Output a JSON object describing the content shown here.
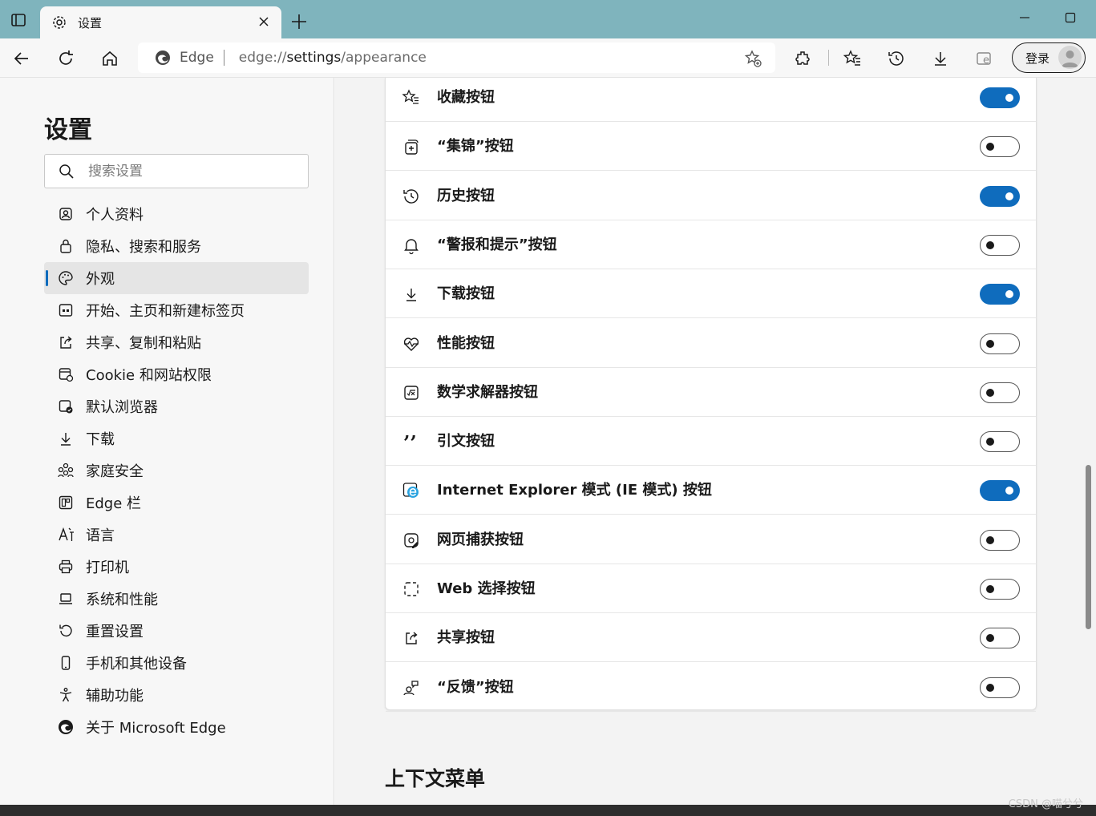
{
  "tab": {
    "title": "设置",
    "icon": "gear-icon"
  },
  "address_bar": {
    "site_name": "Edge",
    "url_prefix": "edge://",
    "url_host": "settings",
    "url_path": "/appearance"
  },
  "toolbar": {
    "login_label": "登录"
  },
  "sidebar": {
    "title": "设置",
    "search_placeholder": "搜索设置",
    "items": [
      {
        "label": "个人资料",
        "icon": "profile-icon"
      },
      {
        "label": "隐私、搜索和服务",
        "icon": "lock-icon"
      },
      {
        "label": "外观",
        "icon": "palette-icon",
        "active": true
      },
      {
        "label": "开始、主页和新建标签页",
        "icon": "start-page-icon"
      },
      {
        "label": "共享、复制和粘贴",
        "icon": "share-icon"
      },
      {
        "label": "Cookie 和网站权限",
        "icon": "site-permissions-icon"
      },
      {
        "label": "默认浏览器",
        "icon": "default-browser-icon"
      },
      {
        "label": "下载",
        "icon": "download-icon"
      },
      {
        "label": "家庭安全",
        "icon": "family-icon"
      },
      {
        "label": "Edge 栏",
        "icon": "edge-bar-icon"
      },
      {
        "label": "语言",
        "icon": "language-icon"
      },
      {
        "label": "打印机",
        "icon": "printer-icon"
      },
      {
        "label": "系统和性能",
        "icon": "laptop-icon"
      },
      {
        "label": "重置设置",
        "icon": "reset-icon"
      },
      {
        "label": "手机和其他设备",
        "icon": "phone-icon"
      },
      {
        "label": "辅助功能",
        "icon": "accessibility-icon"
      },
      {
        "label": "关于 Microsoft Edge",
        "icon": "edge-logo-icon"
      }
    ]
  },
  "main": {
    "rows": [
      {
        "label": "收藏按钮",
        "icon": "favorites-icon",
        "enabled": true
      },
      {
        "label": "“集锦”按钮",
        "icon": "collections-icon",
        "enabled": false
      },
      {
        "label": "历史按钮",
        "icon": "history-icon",
        "enabled": true
      },
      {
        "label": "“警报和提示”按钮",
        "icon": "bell-icon",
        "enabled": false
      },
      {
        "label": "下载按钮",
        "icon": "download-icon",
        "enabled": true
      },
      {
        "label": "性能按钮",
        "icon": "performance-icon",
        "enabled": false
      },
      {
        "label": "数学求解器按钮",
        "icon": "math-solver-icon",
        "enabled": false
      },
      {
        "label": "引文按钮",
        "icon": "citation-icon",
        "enabled": false
      },
      {
        "label": "Internet Explorer 模式 (IE 模式) 按钮",
        "icon": "ie-mode-icon",
        "enabled": true
      },
      {
        "label": "网页捕获按钮",
        "icon": "web-capture-icon",
        "enabled": false
      },
      {
        "label": "Web 选择按钮",
        "icon": "web-select-icon",
        "enabled": false
      },
      {
        "label": "共享按钮",
        "icon": "share-icon",
        "enabled": false
      },
      {
        "label": "“反馈”按钮",
        "icon": "feedback-icon",
        "enabled": false
      }
    ],
    "next_section_title": "上下文菜单"
  },
  "watermark": "CSDN @喵兮兮",
  "colors": {
    "titlebar": "#7fb4bd",
    "accent": "#0f6cbd"
  }
}
